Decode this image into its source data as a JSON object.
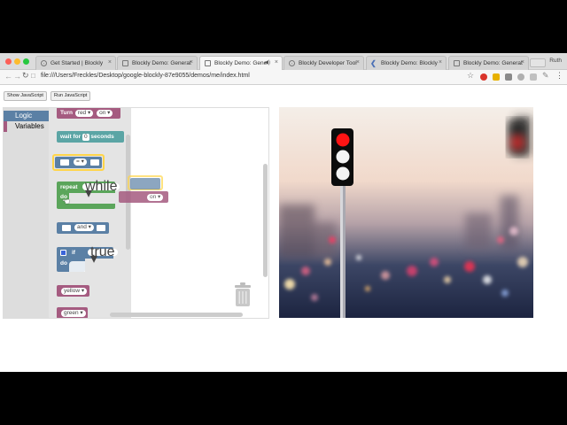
{
  "tabs": [
    {
      "label": "Get Started | Blockly",
      "active": false
    },
    {
      "label": "Blockly Demo: Generat",
      "active": false
    },
    {
      "label": "Blockly Demo: Gene",
      "active": true
    },
    {
      "label": "Blockly Developer Tool",
      "active": false
    },
    {
      "label": "Blockly Demo: Blockly",
      "active": false
    },
    {
      "label": "Blockly Demo: Generat",
      "active": false
    }
  ],
  "profile_name": "Ruth",
  "address_bar": {
    "url": "file:///Users/Freckles/Desktop/google-blockly-87e9055/demos/me/index.html"
  },
  "page_buttons": {
    "show_js": "Show JavaScript",
    "run_js": "Run JavaScript"
  },
  "toolbox": {
    "categories": [
      {
        "label": "Logic",
        "selected": true,
        "color": "#5b80a5"
      },
      {
        "label": "Variables",
        "selected": false,
        "color": "#a55b80"
      }
    ]
  },
  "flyout_blocks": {
    "turn": {
      "label": "Turn",
      "color_value": "red",
      "state_value": "on"
    },
    "wait": {
      "prefix": "wait for",
      "amount": "0",
      "suffix": "seconds"
    },
    "compare": {
      "operator": "="
    },
    "repeat": {
      "label": "repeat",
      "mode": "while",
      "do_label": "do"
    },
    "and_block": {
      "operator": "and"
    },
    "if_block": {
      "if_label": "if",
      "value": "true",
      "do_label": "do"
    },
    "yellow": {
      "label": "yellow"
    },
    "green": {
      "label": "green"
    }
  },
  "dragged_ghost": {
    "state_value": "on"
  },
  "colors": {
    "logic": "#5b80a5",
    "loops": "#5ba55b",
    "variables": "#a55b80",
    "math": "#5ba5a5",
    "highlight": "#ffd54a"
  }
}
